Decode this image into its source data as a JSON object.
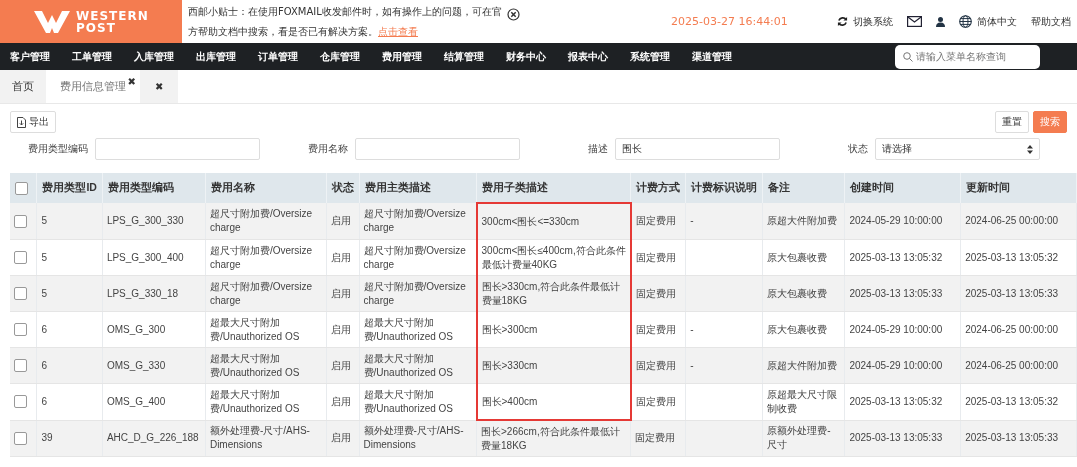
{
  "header": {
    "logo": {
      "line1": "WESTERN",
      "line2": "POST"
    },
    "notice": {
      "text": "西邮小贴士：在使用FOXMAIL收发邮件时，如有操作上的问题，可在官方帮助文档中搜索，看是否已有解决方案。",
      "link": "点击查看"
    },
    "datetime": "2025-03-27 16:44:01",
    "switch_system": "切换系统",
    "language": "简体中文",
    "help": "帮助文档"
  },
  "nav": {
    "items": [
      "客户管理",
      "工单管理",
      "入库管理",
      "出库管理",
      "订单管理",
      "仓库管理",
      "费用管理",
      "结算管理",
      "财务中心",
      "报表中心",
      "系统管理",
      "渠道管理"
    ],
    "search_placeholder": "请输入菜单名称查询"
  },
  "tabs": [
    {
      "label": "首页",
      "selected": false
    },
    {
      "label": "费用信息管理",
      "selected": true,
      "close": "✖"
    },
    {
      "label": "✖",
      "selected": false
    }
  ],
  "toolbar": {
    "export": "导出",
    "reset": "重置",
    "search": "搜索"
  },
  "filters": [
    {
      "kind": "text",
      "label": "费用类型编码"
    },
    {
      "kind": "text",
      "label": "费用名称"
    },
    {
      "kind": "text",
      "label": "描述",
      "value": "围长"
    },
    {
      "kind": "select",
      "label": "状态",
      "value": "请选择"
    }
  ],
  "table": {
    "columns": [
      "费用类型ID",
      "费用类型编码",
      "费用名称",
      "状态",
      "费用主类描述",
      "费用子类描述",
      "计费方式",
      "计费标识说明",
      "备注",
      "创建时间",
      "更新时间"
    ],
    "header_checked": false,
    "rows": [
      {
        "checked": false,
        "highlighted": true,
        "cells": [
          "5",
          "LPS_G_300_330",
          "超尺寸附加费/Oversize charge",
          "启用",
          "超尺寸附加费/Oversize charge",
          "300cm<围长<=330cm",
          "固定费用",
          "-",
          "原超大件附加费",
          "2024-05-29 10:00:00",
          "2024-06-25 00:00:00"
        ]
      },
      {
        "checked": false,
        "highlighted": true,
        "cells": [
          "5",
          "LPS_G_300_400",
          "超尺寸附加费/Oversize charge",
          "启用",
          "超尺寸附加费/Oversize charge",
          "300cm<围长≤400cm,符合此条件最低计费量40KG",
          "固定费用",
          "",
          "原大包裹收费",
          "2025-03-13 13:05:32",
          "2025-03-13 13:05:32"
        ]
      },
      {
        "checked": false,
        "highlighted": true,
        "cells": [
          "5",
          "LPS_G_330_18",
          "超尺寸附加费/Oversize charge",
          "启用",
          "超尺寸附加费/Oversize charge",
          "围长>330cm,符合此条件最低计费量18KG",
          "固定费用",
          "",
          "原大包裹收费",
          "2025-03-13 13:05:33",
          "2025-03-13 13:05:33"
        ]
      },
      {
        "checked": false,
        "highlighted": true,
        "cells": [
          "6",
          "OMS_G_300",
          "超最大尺寸附加费/Unauthorized OS",
          "启用",
          "超最大尺寸附加费/Unauthorized OS",
          "围长>300cm",
          "固定费用",
          "-",
          "原大包裹收费",
          "2024-05-29 10:00:00",
          "2024-06-25 00:00:00"
        ]
      },
      {
        "checked": false,
        "highlighted": true,
        "cells": [
          "6",
          "OMS_G_330",
          "超最大尺寸附加费/Unauthorized OS",
          "启用",
          "超最大尺寸附加费/Unauthorized OS",
          "围长>330cm",
          "固定费用",
          "-",
          "原超大件附加费",
          "2024-05-29 10:00:00",
          "2024-06-25 00:00:00"
        ]
      },
      {
        "checked": false,
        "highlighted": true,
        "cells": [
          "6",
          "OMS_G_400",
          "超最大尺寸附加费/Unauthorized OS",
          "启用",
          "超最大尺寸附加费/Unauthorized OS",
          "围长>400cm",
          "固定费用",
          "",
          "原超最大尺寸限制收费",
          "2025-03-13 13:05:32",
          "2025-03-13 13:05:32"
        ]
      },
      {
        "checked": false,
        "highlighted": false,
        "cells": [
          "39",
          "AHC_D_G_226_188",
          "额外处理费-尺寸/AHS-Dimensions",
          "启用",
          "额外处理费-尺寸/AHS-Dimensions",
          "围长>266cm,符合此条件最低计费量18KG",
          "固定费用",
          "",
          "原额外处理费-尺寸",
          "2025-03-13 13:05:33",
          "2025-03-13 13:05:33"
        ]
      }
    ]
  }
}
